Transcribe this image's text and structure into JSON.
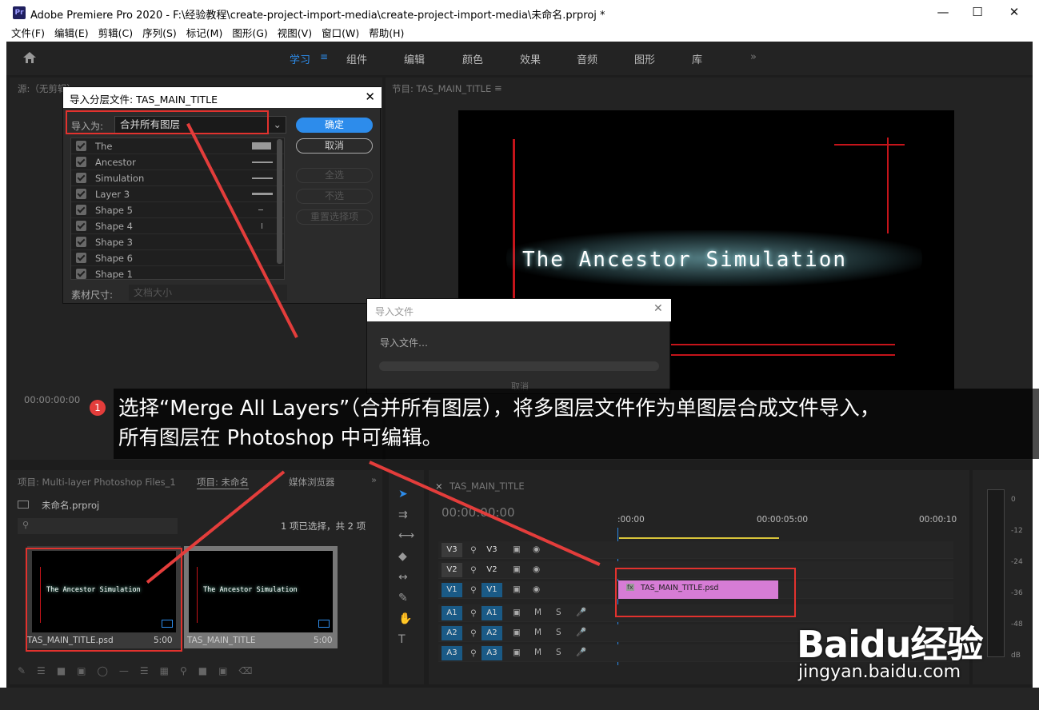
{
  "window": {
    "title": "Adobe Premiere Pro 2020 - F:\\经验教程\\create-project-import-media\\create-project-import-media\\未命名.prproj *",
    "logo": "Pr"
  },
  "menu": [
    "文件(F)",
    "编辑(E)",
    "剪辑(C)",
    "序列(S)",
    "标记(M)",
    "图形(G)",
    "视图(V)",
    "窗口(W)",
    "帮助(H)"
  ],
  "workspaces": [
    "学习",
    "组件",
    "编辑",
    "颜色",
    "效果",
    "音频",
    "图形",
    "库"
  ],
  "source_panel": {
    "title": "源:（无剪辑）",
    "timecode": "00:00:00:00"
  },
  "program_panel": {
    "title": "节目: TAS_MAIN_TITLE",
    "overlay_title": "The Ancestor Simulation"
  },
  "import_dialog": {
    "title": "导入分层文件: TAS_MAIN_TITLE",
    "import_as_label": "导入为:",
    "import_as_value": "合并所有图层",
    "ok": "确定",
    "cancel": "取消",
    "select_all": "全选",
    "select_none": "不选",
    "reset": "重置选择项",
    "footage_size_label": "素材尺寸:",
    "footage_size_value": "文档大小",
    "layers": [
      "The",
      "Ancestor",
      "Simulation",
      "Layer 3",
      "Shape 5",
      "Shape 4",
      "Shape 3",
      "Shape 6",
      "Shape 1"
    ]
  },
  "progress_dialog": {
    "title": "导入文件",
    "message": "导入文件…",
    "cancel": "取消"
  },
  "caption": {
    "badge": "1",
    "line1": "选择“Merge All Layers”（合并所有图层），将多图层文件作为单图层合成文件导入，",
    "line2": "所有图层在 Photoshop 中可编辑。"
  },
  "project_panel": {
    "tab1": "项目: Multi-layer Photoshop Files_1",
    "tab2": "项目: 未命名",
    "tab3": "媒体浏览器",
    "file": "未命名.prproj",
    "selection": "1 项已选择，共 2 项",
    "items": [
      {
        "name": "TAS_MAIN_TITLE.psd",
        "duration": "5:00",
        "thumb_text": "The Ancestor Simulation"
      },
      {
        "name": "TAS_MAIN_TITLE",
        "duration": "5:00",
        "thumb_text": "The Ancestor Simulation"
      }
    ]
  },
  "timeline": {
    "tab": "TAS_MAIN_TITLE",
    "timecode": "00:00:00:00",
    "ruler": [
      ":00:00",
      "00:00:05:00",
      "00:00:10"
    ],
    "video_tracks": [
      "V3",
      "V2",
      "V1"
    ],
    "audio_tracks": [
      "A1",
      "A2",
      "A3"
    ],
    "m": "M",
    "s": "S",
    "fx": "fx",
    "clip": "TAS_MAIN_TITLE.psd"
  },
  "meter": {
    "labels": [
      "0",
      "-12",
      "-24",
      "-36",
      "-48",
      "dB"
    ],
    "solo": "S"
  },
  "watermark": {
    "brand": "Baidu经验",
    "url": "jingyan.baidu.com"
  }
}
